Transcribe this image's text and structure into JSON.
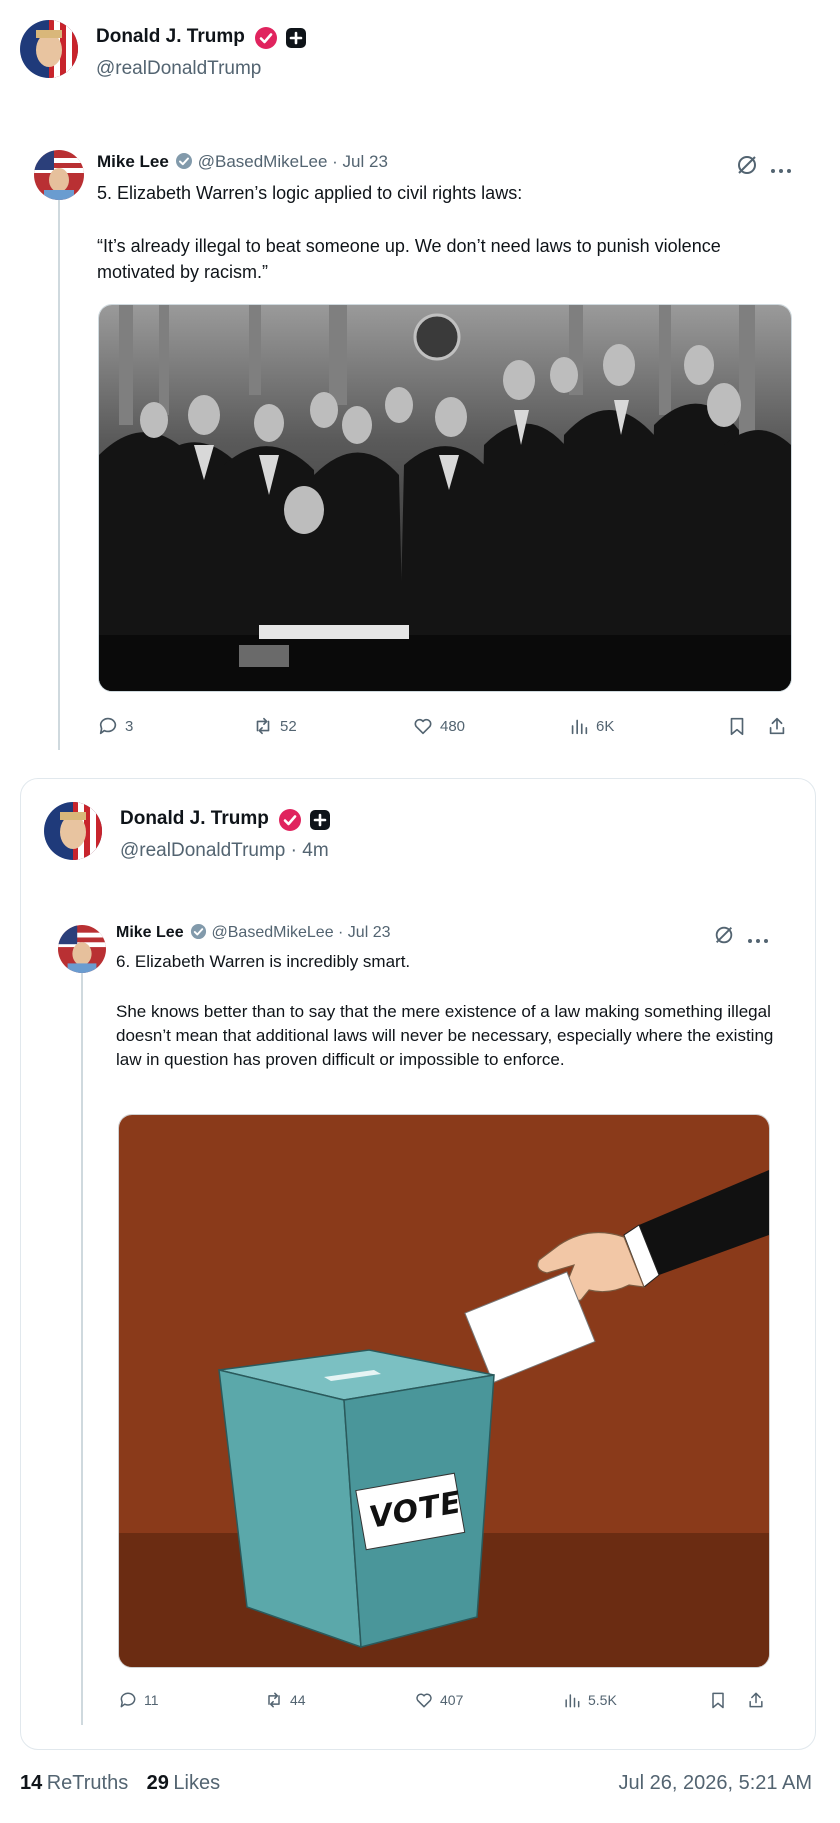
{
  "post": {
    "author_name": "Donald J. Trump",
    "author_handle": "@realDonaldTrump"
  },
  "quote1": {
    "author_name": "Mike Lee",
    "author_handle": "@BasedMikeLee · Jul 23",
    "text_line1": "5. Elizabeth Warren’s logic applied to civil rights laws:",
    "text_quote": "“It’s already illegal to beat someone up. We don’t need laws to punish violence motivated by racism.”",
    "replies": "3",
    "retweets": "52",
    "likes": "480",
    "views": "6K"
  },
  "repost": {
    "author_name": "Donald J. Trump",
    "author_handle": "@realDonaldTrump · 4m"
  },
  "quote2": {
    "author_name": "Mike Lee",
    "author_handle": "@BasedMikeLee · Jul 23",
    "text_line1": "6. Elizabeth Warren is incredibly smart.",
    "text_body": "She knows better than to say that the mere existence of a law making something illegal doesn’t mean that additional laws will never be necessary, especially where the existing law in question has proven difficult or impossible to enforce.",
    "ballot_label": "VOTE",
    "replies": "11",
    "retweets": "44",
    "likes": "407",
    "views": "5.5K"
  },
  "footer": {
    "retruths_count": "14",
    "retruths_label": "ReTruths",
    "likes_count": "29",
    "likes_label": "Likes",
    "timestamp": "Jul 26, 2026, 5:21 AM"
  },
  "colors": {
    "verified_pink": "#e0245e",
    "verified_gray": "#829aab",
    "muted": "#536471",
    "ballot_bg": "#8b3a1a",
    "ballot_box": "#5ba8aa"
  },
  "icons": [
    "reply-icon",
    "retweet-icon",
    "like-icon",
    "views-icon",
    "bookmark-icon",
    "share-icon",
    "grok-icon",
    "more-icon",
    "verified-badge-icon",
    "plus-badge-icon"
  ]
}
